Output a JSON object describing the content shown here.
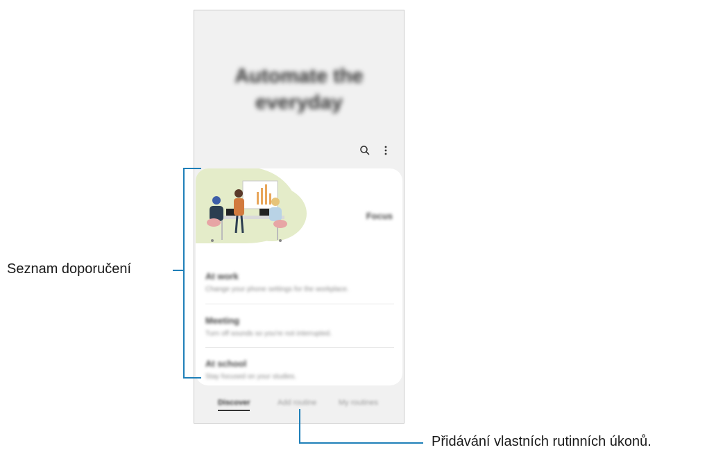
{
  "phone": {
    "headline_line1": "Automate the",
    "headline_line2": "everyday",
    "toolbar": {
      "search_icon": "search-icon",
      "more_icon": "more-vert-icon"
    },
    "recommendation_card": {
      "illustration": "meeting-presentation-illustration",
      "label": "Focus",
      "items": [
        {
          "title": "At work",
          "subtitle": "Change your phone settings for the workplace."
        },
        {
          "title": "Meeting",
          "subtitle": "Turn off sounds so you're not interrupted."
        },
        {
          "title": "At school",
          "subtitle": "Stay focused on your studies."
        }
      ]
    },
    "tabs": [
      {
        "label": "Discover"
      },
      {
        "label": "Add routine"
      },
      {
        "label": "My routines"
      }
    ]
  },
  "callouts": {
    "recommendations_list": "Seznam doporučení",
    "add_custom_routines": "Přidávání vlastních rutinních úkonů."
  },
  "colors": {
    "callout_line": "#1e7fb8",
    "illustration_bg": "#e4ecc9",
    "screen_bg": "#f1f1f1"
  }
}
